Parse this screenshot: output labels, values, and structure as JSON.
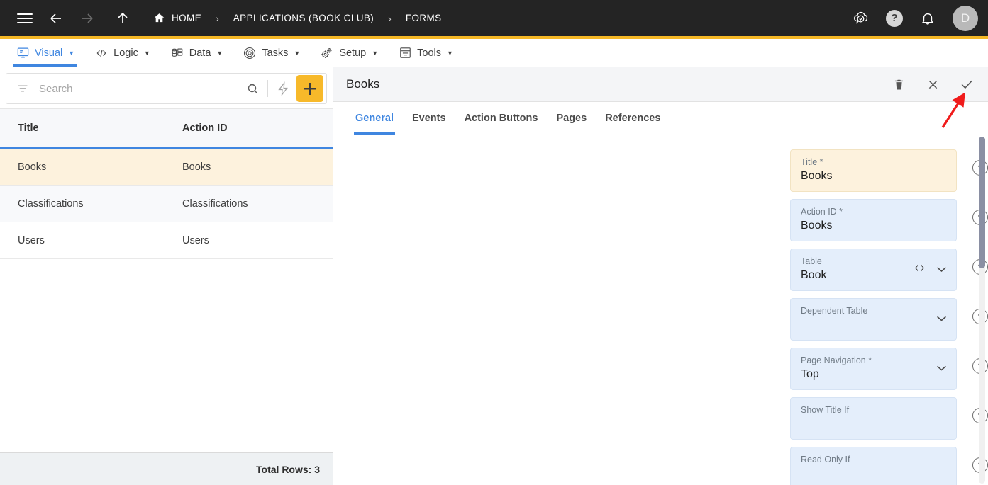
{
  "topbar": {
    "menu_icon": "hamburger-menu-icon",
    "back_icon": "arrow-left-icon",
    "forward_icon": "arrow-right-icon",
    "up_icon": "arrow-up-icon",
    "home_icon": "home-icon",
    "breadcrumbs": [
      {
        "label": "HOME",
        "icon": "home-icon"
      },
      {
        "label": "APPLICATIONS (BOOK CLUB)",
        "icon": ""
      },
      {
        "label": "FORMS",
        "icon": ""
      }
    ],
    "separator": "›",
    "right_icons": [
      {
        "name": "cloud-search-icon",
        "label": ""
      },
      {
        "name": "help-circle-icon",
        "label": "?"
      },
      {
        "name": "notifications-bell-icon",
        "label": ""
      }
    ],
    "avatar_initial": "D",
    "accent_color": "#f5b826",
    "background_color": "#242424"
  },
  "modulenav": {
    "items": [
      {
        "label": "Visual",
        "icon": "monitor-icon",
        "active": true
      },
      {
        "label": "Logic",
        "icon": "code-brackets-icon",
        "active": false
      },
      {
        "label": "Data",
        "icon": "database-table-icon",
        "active": false
      },
      {
        "label": "Tasks",
        "icon": "target-icon",
        "active": false
      },
      {
        "label": "Setup",
        "icon": "gears-icon",
        "active": false
      },
      {
        "label": "Tools",
        "icon": "toolbox-icon",
        "active": false
      }
    ],
    "caret": "▼",
    "active_color": "#3f86e0"
  },
  "sidebar": {
    "search": {
      "placeholder": "Search",
      "value": "",
      "filter_icon": "filter-icon",
      "search_icon": "search-icon",
      "lightning_icon": "lightning-bolt-icon",
      "add_icon": "plus-icon",
      "add_button_color": "#f7b92a"
    },
    "table": {
      "columns": [
        "Title",
        "Action ID"
      ],
      "rows": [
        {
          "title": "Books",
          "action_id": "Books",
          "selected": true
        },
        {
          "title": "Classifications",
          "action_id": "Classifications",
          "selected": false
        },
        {
          "title": "Users",
          "action_id": "Users",
          "selected": false
        }
      ],
      "selected_row_color": "#fdf2dd",
      "header_underline_color": "#3f86e0"
    },
    "footer": {
      "total_rows_label": "Total Rows: 3"
    }
  },
  "detail": {
    "title": "Books",
    "header_actions": [
      {
        "name": "delete-button",
        "icon": "trash-icon"
      },
      {
        "name": "close-button",
        "icon": "close-x-icon"
      },
      {
        "name": "save-button",
        "icon": "checkmark-icon"
      }
    ],
    "tabs": [
      {
        "label": "General",
        "active": true
      },
      {
        "label": "Events",
        "active": false
      },
      {
        "label": "Action Buttons",
        "active": false
      },
      {
        "label": "Pages",
        "active": false
      },
      {
        "label": "References",
        "active": false
      }
    ],
    "fields": [
      {
        "label": "Title *",
        "value": "Books",
        "highlight": true,
        "dropdown": false,
        "code": false,
        "help": "help-circle-icon"
      },
      {
        "label": "Action ID *",
        "value": "Books",
        "highlight": false,
        "dropdown": false,
        "code": false,
        "help": "help-circle-icon"
      },
      {
        "label": "Table",
        "value": "Book",
        "highlight": false,
        "dropdown": true,
        "code": true,
        "help": "help-circle-icon"
      },
      {
        "label": "Dependent Table",
        "value": "",
        "highlight": false,
        "dropdown": true,
        "code": false,
        "help": "help-circle-icon"
      },
      {
        "label": "Page Navigation *",
        "value": "Top",
        "highlight": false,
        "dropdown": true,
        "code": false,
        "help": "help-circle-icon"
      },
      {
        "label": "Show Title If",
        "value": "",
        "highlight": false,
        "dropdown": false,
        "code": false,
        "help": "help-circle-icon"
      },
      {
        "label": "Read Only If",
        "value": "",
        "highlight": false,
        "dropdown": false,
        "code": false,
        "help": "help-circle-icon"
      }
    ],
    "annotation": {
      "name": "red-arrow-annotation",
      "points_to": "save-button",
      "color": "#f01b1b"
    },
    "scrollbar": {
      "name": "vertical-scrollbar"
    }
  }
}
